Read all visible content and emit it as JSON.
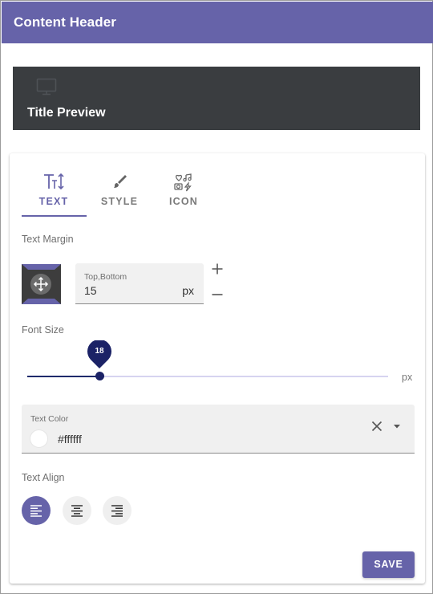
{
  "header": {
    "title": "Content Header"
  },
  "preview": {
    "title": "Title Preview",
    "icon": "monitor-icon"
  },
  "tabs": [
    {
      "label": "TEXT",
      "icon": "text-size-icon",
      "active": true
    },
    {
      "label": "STYLE",
      "icon": "brush-icon",
      "active": false
    },
    {
      "label": "ICON",
      "icon": "icon-collection-icon",
      "active": false
    }
  ],
  "text_margin": {
    "label": "Text Margin",
    "field_label": "Top,Bottom",
    "value": "15",
    "unit": "px"
  },
  "font_size": {
    "label": "Font Size",
    "value": "18",
    "unit": "px",
    "level": 0.2
  },
  "text_color": {
    "label": "Text Color",
    "value": "#ffffff"
  },
  "text_align": {
    "label": "Text Align",
    "options": [
      "left",
      "center",
      "right"
    ],
    "selected": "left"
  },
  "actions": {
    "save_label": "SAVE"
  },
  "colors": {
    "accent": "#6663a9",
    "preview_bg": "#3a3d40",
    "slider_active": "#1b2266",
    "slider_inactive": "#d6d3f0"
  }
}
